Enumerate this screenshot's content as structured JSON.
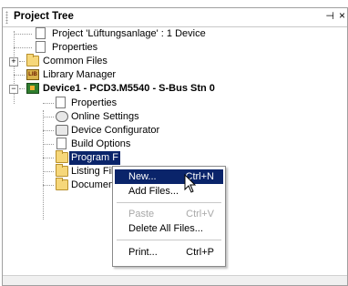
{
  "panel": {
    "title": "Project Tree",
    "pin_icon": "⊣",
    "close_icon": "×"
  },
  "tree": {
    "project": "Project 'Lüftungsanlage' : 1 Device",
    "properties": "Properties",
    "common_files": "Common Files",
    "library_manager": "Library Manager",
    "device": "Device1 - PCD3.M5540 - S-Bus Stn 0",
    "device_properties": "Properties",
    "online_settings": "Online Settings",
    "device_configurator": "Device Configurator",
    "build_options": "Build Options",
    "program_files": "Program F",
    "listing_files": "Listing File",
    "documentation": "Document",
    "expand_plus": "+",
    "expand_minus": "−"
  },
  "context_menu": {
    "new": "New...",
    "new_shortcut": "Ctrl+N",
    "add_files": "Add Files...",
    "paste": "Paste",
    "paste_shortcut": "Ctrl+V",
    "delete_all": "Delete All Files...",
    "print": "Print...",
    "print_shortcut": "Ctrl+P"
  },
  "colors": {
    "selection": "#0a246a",
    "folder": "#f6d77a"
  }
}
